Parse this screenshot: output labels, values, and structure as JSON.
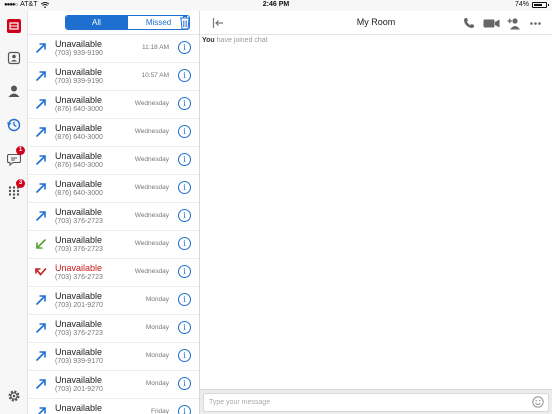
{
  "status_bar": {
    "carrier": "AT&T",
    "time": "2:46 PM",
    "battery": "74%",
    "battery_level": 0.74
  },
  "rail": {
    "items": [
      {
        "name": "app-logo-icon"
      },
      {
        "name": "contacts-card-icon"
      },
      {
        "name": "person-icon"
      },
      {
        "name": "recents-icon"
      },
      {
        "name": "chat-icon",
        "badge": "1"
      },
      {
        "name": "dialpad-icon",
        "badge": "3"
      },
      {
        "name": "settings-icon"
      }
    ],
    "accent": "#1f6fd1",
    "badge_color": "#d0021b"
  },
  "call_list": {
    "tabs": {
      "all": "All",
      "missed": "Missed"
    },
    "rows": [
      {
        "name": "Unavailable",
        "number": "(703) 939-9190",
        "time": "11:18 AM",
        "type": "outgoing"
      },
      {
        "name": "Unavailable",
        "number": "(703) 939-9190",
        "time": "10:57 AM",
        "type": "outgoing"
      },
      {
        "name": "Unavailable",
        "number": "(876) 640-3000",
        "time": "Wednesday",
        "type": "outgoing"
      },
      {
        "name": "Unavailable",
        "number": "(876) 640-3000",
        "time": "Wednesday",
        "type": "outgoing"
      },
      {
        "name": "Unavailable",
        "number": "(876) 640-3000",
        "time": "Wednesday",
        "type": "outgoing"
      },
      {
        "name": "Unavailable",
        "number": "(876) 640-3000",
        "time": "Wednesday",
        "type": "outgoing"
      },
      {
        "name": "Unavailable",
        "number": "(703) 376-2723",
        "time": "Wednesday",
        "type": "outgoing"
      },
      {
        "name": "Unavailable",
        "number": "(703) 376-2723",
        "time": "Wednesday",
        "type": "incoming"
      },
      {
        "name": "Unavailable",
        "number": "(703) 376-2723",
        "time": "Wednesday",
        "type": "missed"
      },
      {
        "name": "Unavailable",
        "number": "(703) 201-9270",
        "time": "Monday",
        "type": "outgoing"
      },
      {
        "name": "Unavailable",
        "number": "(703) 376-2723",
        "time": "Monday",
        "type": "outgoing"
      },
      {
        "name": "Unavailable",
        "number": "(703) 939-9170",
        "time": "Monday",
        "type": "outgoing"
      },
      {
        "name": "Unavailable",
        "number": "(703) 201-9270",
        "time": "Monday",
        "type": "outgoing"
      },
      {
        "name": "Unavailable",
        "number": "",
        "time": "Friday",
        "type": "outgoing"
      }
    ],
    "colors": {
      "outgoing": "#1f6fd1",
      "incoming": "#5aa02c",
      "missed": "#c41a1a"
    }
  },
  "chat": {
    "title": "My Room",
    "message_sender": "You",
    "message_text": "have joined chat",
    "input_placeholder": "Type your message"
  }
}
